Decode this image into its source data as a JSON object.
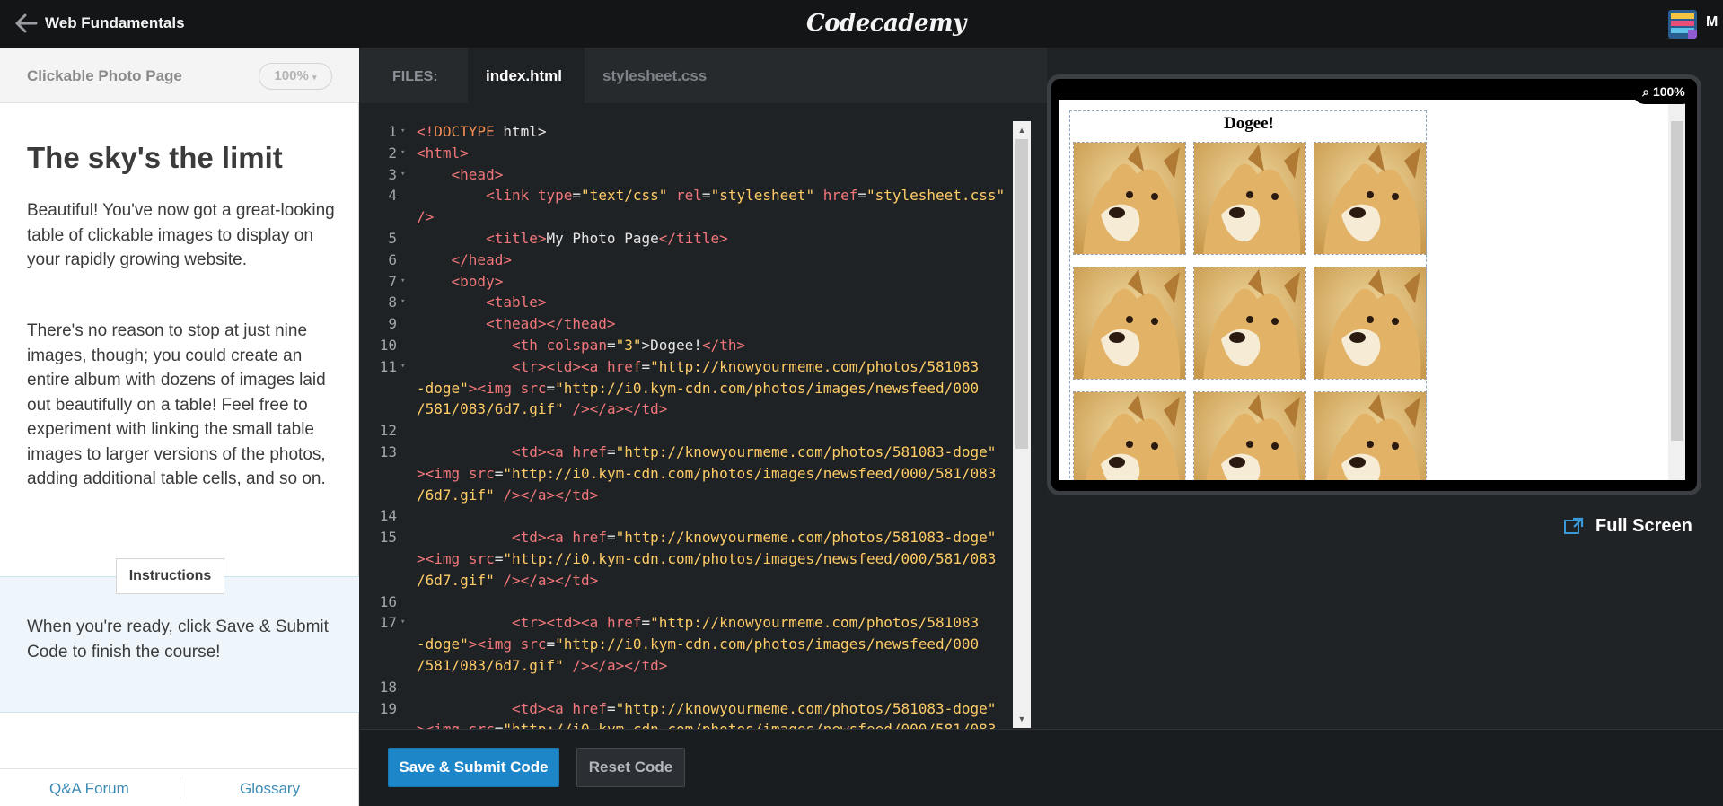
{
  "topbar": {
    "course_title": "Web Fundamentals",
    "logo": "Codecademy",
    "avatar_letter": "M"
  },
  "lesson": {
    "name": "Clickable Photo Page",
    "zoom": "100%",
    "title": "The sky's the limit",
    "paragraphs": [
      "Beautiful! You've now got a great-looking table of clickable images to display on your rapidly growing website.",
      "There's no reason to stop at just nine images, though; you could create an entire album with dozens of images laid out beautifully on a table! Feel free to experiment with linking the small table images to larger versions of the photos, adding additional table cells, and so on."
    ],
    "instructions_label": "Instructions",
    "instructions_text": "When you're ready, click Save & Submit Code to finish the course!",
    "footer": {
      "forum": "Q&A Forum",
      "glossary": "Glossary"
    }
  },
  "editor": {
    "files_label": "FILES:",
    "tabs": [
      "index.html",
      "stylesheet.css"
    ],
    "active_tab": "index.html",
    "line_numbers": [
      "1",
      "2",
      "3",
      "4",
      "",
      "5",
      "6",
      "7",
      "8",
      "9",
      "10",
      "11",
      "",
      "",
      "12",
      "13",
      "",
      "",
      "14",
      "15",
      "",
      "",
      "16",
      "17",
      "",
      "",
      "18",
      "19"
    ],
    "save_button": "Save & Submit Code",
    "reset_button": "Reset Code"
  },
  "preview": {
    "zoom": "100%",
    "table_heading": "Dogee!",
    "fullscreen_label": "Full Screen"
  }
}
